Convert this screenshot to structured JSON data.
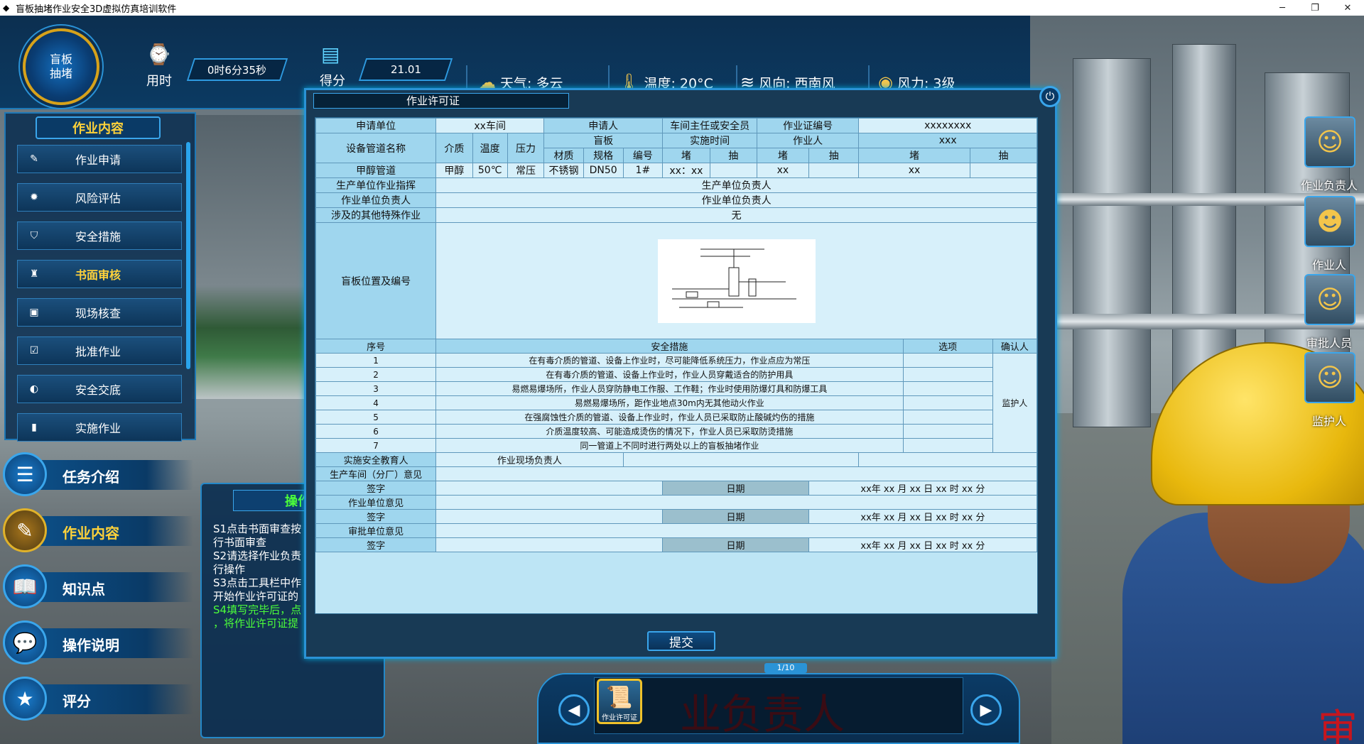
{
  "window": {
    "title": "盲板抽堵作业安全3D虚拟仿真培训软件",
    "min": "─",
    "max": "❐",
    "close": "✕"
  },
  "hud": {
    "logo": "盲板\n抽堵",
    "time_label": "用时",
    "time_value": "0时6分35秒",
    "score_label": "得分",
    "score_value": "21.01",
    "weather": "天气: 多云",
    "temperature": "温度: 20°C",
    "wind_dir": "风向: 西南风",
    "wind_force": "风力: 3级"
  },
  "left_panel": {
    "title": "作业内容",
    "items": [
      {
        "label": "作业申请",
        "icon": "pen-icon"
      },
      {
        "label": "风险评估",
        "icon": "fire-icon"
      },
      {
        "label": "安全措施",
        "icon": "shield-icon"
      },
      {
        "label": "书面审核",
        "icon": "stamp-icon",
        "active": true
      },
      {
        "label": "现场核查",
        "icon": "check-doc-icon"
      },
      {
        "label": "批准作业",
        "icon": "clipboard-icon"
      },
      {
        "label": "安全交底",
        "icon": "shield-half-icon"
      },
      {
        "label": "实施作业",
        "icon": "tool-icon"
      }
    ]
  },
  "nav": [
    {
      "label": "任务介绍"
    },
    {
      "label": "作业内容",
      "active": true
    },
    {
      "label": "知识点"
    },
    {
      "label": "操作说明"
    },
    {
      "label": "评分"
    }
  ],
  "guide": {
    "title": "操作指",
    "lines": [
      "S1点击书面审查按",
      "行书面审查",
      "S2请选择作业负责",
      "行操作",
      "S3点击工具栏中作",
      "开始作业许可证的"
    ],
    "green_lines": [
      "S4填写完毕后，点",
      "，将作业许可证提"
    ]
  },
  "roles": [
    {
      "name": "作业负责人"
    },
    {
      "name": "作业人"
    },
    {
      "name": "审批人员"
    },
    {
      "name": "监护人"
    }
  ],
  "dialog": {
    "title": "作业许可证",
    "submit": "提交",
    "permit": {
      "h_apply_unit": "申请单位",
      "apply_unit": "xx车间",
      "h_applicant": "申请人",
      "h_workshop": "车间主任或安全员",
      "h_cert_no": "作业证编号",
      "cert_no": "xxxxxxxx",
      "h_equipment": "设备管道名称",
      "h_medium": "介质",
      "h_temp": "温度",
      "h_pressure": "压力",
      "h_blind": "盲板",
      "h_material": "材质",
      "h_spec": "规格",
      "h_number": "编号",
      "h_exec_time": "实施时间",
      "h_plug": "堵",
      "h_pull": "抽",
      "h_worker": "作业人",
      "worker": "xxx",
      "equipment": "甲醇管道",
      "medium": "甲醇",
      "temp": "50℃",
      "pressure": "常压",
      "material": "不锈钢",
      "spec": "DN50",
      "number": "1#",
      "plug_time": "xx：xx",
      "worker_plug": "xx",
      "person_plug": "xx",
      "h_commander": "生产单位作业指挥",
      "commander": "生产单位负责人",
      "h_unit_leader": "作业单位负责人",
      "unit_leader": "作业单位负责人",
      "h_other_special": "涉及的其他特殊作业",
      "other_special": "无",
      "h_position": "盲板位置及编号",
      "h_seq": "序号",
      "h_measures": "安全措施",
      "h_option": "选项",
      "h_confirm": "确认人",
      "confirmer": "监护人",
      "measures": [
        {
          "n": "1",
          "t": "在有毒介质的管道、设备上作业时，尽可能降低系统压力，作业点应为常压"
        },
        {
          "n": "2",
          "t": "在有毒介质的管道、设备上作业时，作业人员穿戴适合的防护用具"
        },
        {
          "n": "3",
          "t": "易燃易爆场所，作业人员穿防静电工作服、工作鞋；作业时使用防爆灯具和防爆工具"
        },
        {
          "n": "4",
          "t": "易燃易爆场所，距作业地点30m内无其他动火作业"
        },
        {
          "n": "5",
          "t": "在强腐蚀性介质的管道、设备上作业时，作业人员已采取防止酸碱灼伤的措施"
        },
        {
          "n": "6",
          "t": "介质温度较高、可能造成烫伤的情况下，作业人员已采取防烫措施"
        },
        {
          "n": "7",
          "t": "同一管道上不同时进行两处以上的盲板抽堵作业"
        }
      ],
      "h_educator": "实施安全教育人",
      "educator": "作业现场负责人",
      "h_workshop_opinion": "生产车间（分厂）意见",
      "h_sign": "签字",
      "h_date": "日期",
      "date_value": "xx年 xx 月 xx 日 xx 时 xx 分",
      "h_work_unit_opinion": "作业单位意见",
      "h_approval_opinion": "审批单位意见"
    }
  },
  "toolbar": {
    "page": "1/10",
    "tool_label": "作业许可证",
    "ghost_text": "业负责人",
    "prev": "◀",
    "next": "▶"
  },
  "scene": {
    "corner_text": "审"
  }
}
